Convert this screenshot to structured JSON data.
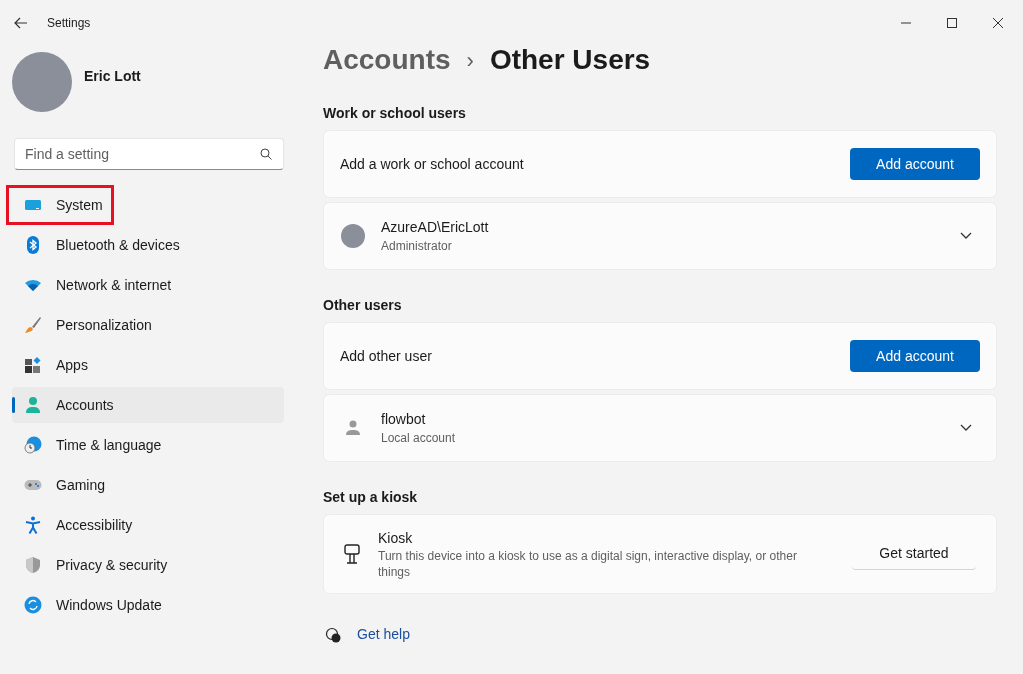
{
  "window": {
    "title": "Settings"
  },
  "profile": {
    "name": "Eric Lott"
  },
  "search": {
    "placeholder": "Find a setting"
  },
  "sidebar": {
    "items": [
      {
        "label": "System",
        "selected": false,
        "highlighted": true
      },
      {
        "label": "Bluetooth & devices",
        "selected": false,
        "highlighted": false
      },
      {
        "label": "Network & internet",
        "selected": false,
        "highlighted": false
      },
      {
        "label": "Personalization",
        "selected": false,
        "highlighted": false
      },
      {
        "label": "Apps",
        "selected": false,
        "highlighted": false
      },
      {
        "label": "Accounts",
        "selected": true,
        "highlighted": false
      },
      {
        "label": "Time & language",
        "selected": false,
        "highlighted": false
      },
      {
        "label": "Gaming",
        "selected": false,
        "highlighted": false
      },
      {
        "label": "Accessibility",
        "selected": false,
        "highlighted": false
      },
      {
        "label": "Privacy & security",
        "selected": false,
        "highlighted": false
      },
      {
        "label": "Windows Update",
        "selected": false,
        "highlighted": false
      }
    ]
  },
  "breadcrumb": {
    "parent": "Accounts",
    "separator": "›",
    "current": "Other Users"
  },
  "sections": [
    {
      "title": "Work or school users",
      "rows": [
        {
          "kind": "action",
          "label": "Add a work or school account",
          "button": "Add account"
        },
        {
          "kind": "user",
          "name": "AzureAD\\EricLott",
          "subtitle": "Administrator",
          "expanded": false
        }
      ]
    },
    {
      "title": "Other users",
      "rows": [
        {
          "kind": "action",
          "label": "Add other user",
          "button": "Add account"
        },
        {
          "kind": "user",
          "name": "flowbot",
          "subtitle": "Local account",
          "expanded": false
        }
      ]
    },
    {
      "title": "Set up a kiosk",
      "rows": [
        {
          "kind": "kiosk",
          "label": "Kiosk",
          "description": "Turn this device into a kiosk to use as a digital sign, interactive display, or other things",
          "button": "Get started"
        }
      ]
    }
  ],
  "help": {
    "label": "Get help"
  }
}
